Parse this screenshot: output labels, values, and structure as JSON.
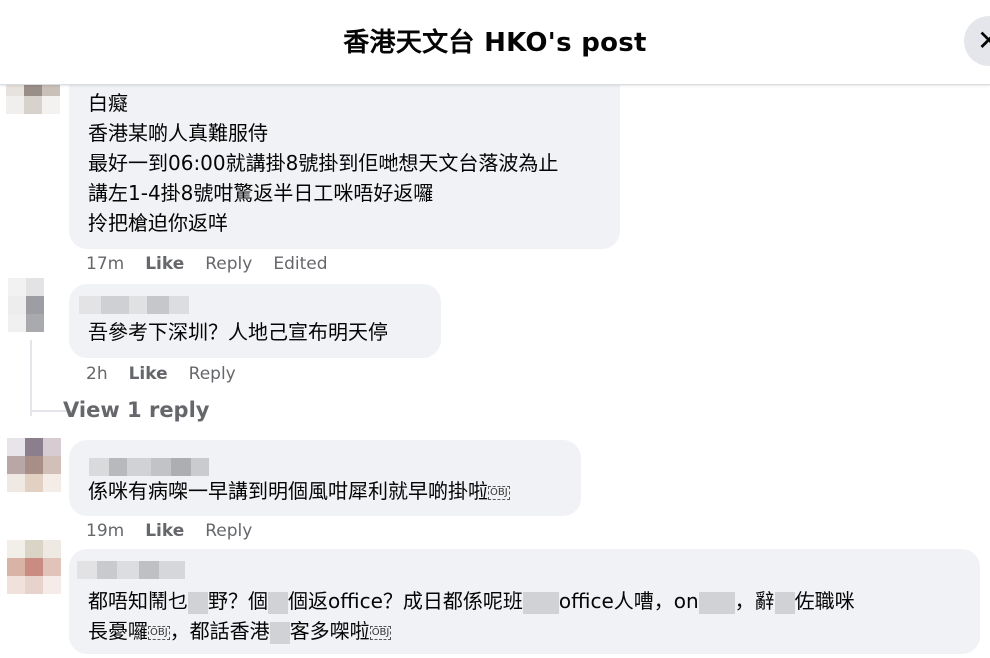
{
  "header": {
    "title": "香港天文台 HKO's post"
  },
  "comments": [
    {
      "lines": [
        "白癡",
        "香港某啲人真難服侍",
        "最好一到06:00就講掛8號掛到佢哋想天文台落波為止",
        "講左1-4掛8號咁驚返半日工咪唔好返囉",
        "拎把槍迫你返咩"
      ],
      "time": "17m",
      "like": "Like",
      "reply": "Reply",
      "edited": "Edited"
    },
    {
      "lines": [
        "吾參考下深圳？人地己宣布明天停"
      ],
      "time": "2h",
      "like": "Like",
      "reply": "Reply"
    },
    {
      "lines": [
        "係咪有病㗎一早講到明個風咁犀利就早啲掛啦"
      ],
      "obj": "OBJ",
      "time": "19m",
      "like": "Like",
      "reply": "Reply"
    },
    {
      "line1": {
        "a": "都唔知鬧乜",
        "b": "野？個",
        "c": "個返office？成日都係呢班",
        "d": "office人嘈，on",
        "e": "，辭",
        "f": "佐職咪"
      },
      "line2": {
        "a": "長憂囉",
        "b": "，都話香港",
        "c": "客多㗎啦"
      },
      "obj": "OBJ"
    }
  ],
  "view_replies": "View 1 reply"
}
